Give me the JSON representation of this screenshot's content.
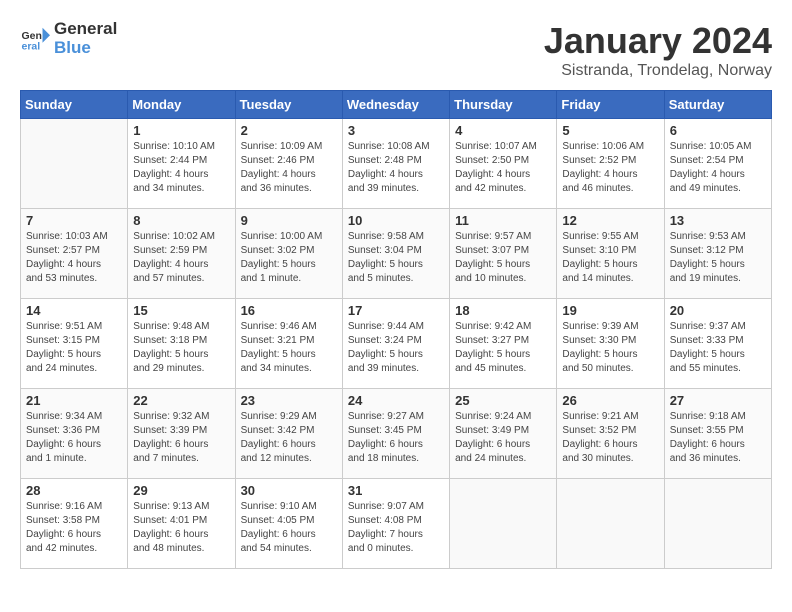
{
  "logo": {
    "text_general": "General",
    "text_blue": "Blue"
  },
  "title": "January 2024",
  "location": "Sistranda, Trondelag, Norway",
  "days_of_week": [
    "Sunday",
    "Monday",
    "Tuesday",
    "Wednesday",
    "Thursday",
    "Friday",
    "Saturday"
  ],
  "weeks": [
    [
      {
        "day": "",
        "info": ""
      },
      {
        "day": "1",
        "info": "Sunrise: 10:10 AM\nSunset: 2:44 PM\nDaylight: 4 hours\nand 34 minutes."
      },
      {
        "day": "2",
        "info": "Sunrise: 10:09 AM\nSunset: 2:46 PM\nDaylight: 4 hours\nand 36 minutes."
      },
      {
        "day": "3",
        "info": "Sunrise: 10:08 AM\nSunset: 2:48 PM\nDaylight: 4 hours\nand 39 minutes."
      },
      {
        "day": "4",
        "info": "Sunrise: 10:07 AM\nSunset: 2:50 PM\nDaylight: 4 hours\nand 42 minutes."
      },
      {
        "day": "5",
        "info": "Sunrise: 10:06 AM\nSunset: 2:52 PM\nDaylight: 4 hours\nand 46 minutes."
      },
      {
        "day": "6",
        "info": "Sunrise: 10:05 AM\nSunset: 2:54 PM\nDaylight: 4 hours\nand 49 minutes."
      }
    ],
    [
      {
        "day": "7",
        "info": "Sunrise: 10:03 AM\nSunset: 2:57 PM\nDaylight: 4 hours\nand 53 minutes."
      },
      {
        "day": "8",
        "info": "Sunrise: 10:02 AM\nSunset: 2:59 PM\nDaylight: 4 hours\nand 57 minutes."
      },
      {
        "day": "9",
        "info": "Sunrise: 10:00 AM\nSunset: 3:02 PM\nDaylight: 5 hours\nand 1 minute."
      },
      {
        "day": "10",
        "info": "Sunrise: 9:58 AM\nSunset: 3:04 PM\nDaylight: 5 hours\nand 5 minutes."
      },
      {
        "day": "11",
        "info": "Sunrise: 9:57 AM\nSunset: 3:07 PM\nDaylight: 5 hours\nand 10 minutes."
      },
      {
        "day": "12",
        "info": "Sunrise: 9:55 AM\nSunset: 3:10 PM\nDaylight: 5 hours\nand 14 minutes."
      },
      {
        "day": "13",
        "info": "Sunrise: 9:53 AM\nSunset: 3:12 PM\nDaylight: 5 hours\nand 19 minutes."
      }
    ],
    [
      {
        "day": "14",
        "info": "Sunrise: 9:51 AM\nSunset: 3:15 PM\nDaylight: 5 hours\nand 24 minutes."
      },
      {
        "day": "15",
        "info": "Sunrise: 9:48 AM\nSunset: 3:18 PM\nDaylight: 5 hours\nand 29 minutes."
      },
      {
        "day": "16",
        "info": "Sunrise: 9:46 AM\nSunset: 3:21 PM\nDaylight: 5 hours\nand 34 minutes."
      },
      {
        "day": "17",
        "info": "Sunrise: 9:44 AM\nSunset: 3:24 PM\nDaylight: 5 hours\nand 39 minutes."
      },
      {
        "day": "18",
        "info": "Sunrise: 9:42 AM\nSunset: 3:27 PM\nDaylight: 5 hours\nand 45 minutes."
      },
      {
        "day": "19",
        "info": "Sunrise: 9:39 AM\nSunset: 3:30 PM\nDaylight: 5 hours\nand 50 minutes."
      },
      {
        "day": "20",
        "info": "Sunrise: 9:37 AM\nSunset: 3:33 PM\nDaylight: 5 hours\nand 55 minutes."
      }
    ],
    [
      {
        "day": "21",
        "info": "Sunrise: 9:34 AM\nSunset: 3:36 PM\nDaylight: 6 hours\nand 1 minute."
      },
      {
        "day": "22",
        "info": "Sunrise: 9:32 AM\nSunset: 3:39 PM\nDaylight: 6 hours\nand 7 minutes."
      },
      {
        "day": "23",
        "info": "Sunrise: 9:29 AM\nSunset: 3:42 PM\nDaylight: 6 hours\nand 12 minutes."
      },
      {
        "day": "24",
        "info": "Sunrise: 9:27 AM\nSunset: 3:45 PM\nDaylight: 6 hours\nand 18 minutes."
      },
      {
        "day": "25",
        "info": "Sunrise: 9:24 AM\nSunset: 3:49 PM\nDaylight: 6 hours\nand 24 minutes."
      },
      {
        "day": "26",
        "info": "Sunrise: 9:21 AM\nSunset: 3:52 PM\nDaylight: 6 hours\nand 30 minutes."
      },
      {
        "day": "27",
        "info": "Sunrise: 9:18 AM\nSunset: 3:55 PM\nDaylight: 6 hours\nand 36 minutes."
      }
    ],
    [
      {
        "day": "28",
        "info": "Sunrise: 9:16 AM\nSunset: 3:58 PM\nDaylight: 6 hours\nand 42 minutes."
      },
      {
        "day": "29",
        "info": "Sunrise: 9:13 AM\nSunset: 4:01 PM\nDaylight: 6 hours\nand 48 minutes."
      },
      {
        "day": "30",
        "info": "Sunrise: 9:10 AM\nSunset: 4:05 PM\nDaylight: 6 hours\nand 54 minutes."
      },
      {
        "day": "31",
        "info": "Sunrise: 9:07 AM\nSunset: 4:08 PM\nDaylight: 7 hours\nand 0 minutes."
      },
      {
        "day": "",
        "info": ""
      },
      {
        "day": "",
        "info": ""
      },
      {
        "day": "",
        "info": ""
      }
    ]
  ]
}
